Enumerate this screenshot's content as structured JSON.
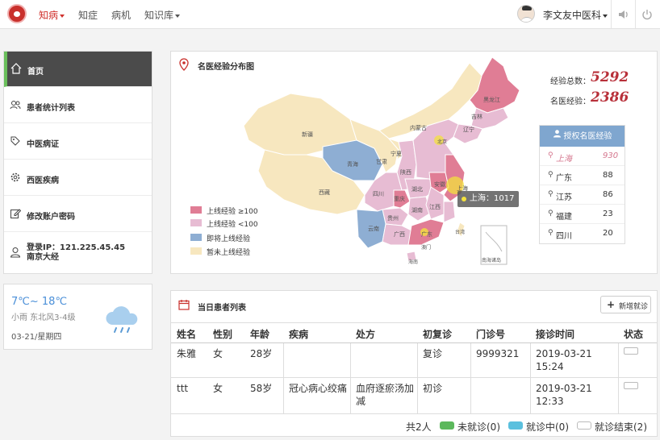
{
  "nav": {
    "items": [
      {
        "label": "知病",
        "has_caret": true,
        "active": true
      },
      {
        "label": "知症",
        "has_caret": false
      },
      {
        "label": "病机",
        "has_caret": false
      },
      {
        "label": "知识库",
        "has_caret": true
      }
    ],
    "user_name": "李文友",
    "department": "中医科",
    "volume_icon": "volume-icon",
    "power_icon": "power-icon"
  },
  "sidebar": {
    "items": [
      {
        "label": "首页",
        "icon": "home-icon",
        "active": true
      },
      {
        "label": "患者统计列表",
        "icon": "users-icon"
      },
      {
        "label": "中医病证",
        "icon": "tag-icon"
      },
      {
        "label": "西医疾病",
        "icon": "gear-icon"
      },
      {
        "label": "修改账户密码",
        "icon": "edit-icon"
      }
    ],
    "login_ip_label": "登录IP：121.225.45.45",
    "login_location": "南京大经"
  },
  "weather": {
    "temp": "7℃~ 18℃",
    "desc": "小雨   东北风3-4级",
    "date": "03-21/星期四"
  },
  "map_panel": {
    "title": "名医经验分布图",
    "total_label": "经验总数：",
    "total_value": "5292",
    "doctor_label": "名医经验：",
    "doctor_value": "2386",
    "ranking_header": "授权名医经验",
    "ranking": [
      {
        "prov": "上海",
        "count": "930",
        "highlight": true
      },
      {
        "prov": "广东",
        "count": "88"
      },
      {
        "prov": "江苏",
        "count": "86"
      },
      {
        "prov": "福建",
        "count": "23"
      },
      {
        "prov": "四川",
        "count": "20"
      }
    ],
    "legend": [
      {
        "label": "上线经验 ≥100",
        "color": "#e07d95"
      },
      {
        "label": "上线经验 <100",
        "color": "#e7bcd3"
      },
      {
        "label": "即将上线经验",
        "color": "#8eaed3"
      },
      {
        "label": "暂未上线经验",
        "color": "#f7e7bf"
      }
    ],
    "tooltip": "上海：1017",
    "map_labels": {
      "heilongjiang": "黑龙江",
      "neimenggu": "内蒙古",
      "jilin": "吉林",
      "xinjiang": "新疆",
      "liaoning": "辽宁",
      "beijing": "北京",
      "ningxia": "宁夏",
      "qinghai": "青海",
      "gansu": "甘肃",
      "shaanxi": "陕西",
      "xizang": "西藏",
      "sichuan": "四川",
      "chongqing": "重庆",
      "anhui": "安徽",
      "shanghai": "上海",
      "hubei": "湖北",
      "jiangxi": "江西",
      "guizhou": "贵州",
      "hunan": "湖南",
      "yunnan": "云南",
      "guangxi": "广西",
      "guangdong": "广东",
      "taiwan": "台湾",
      "aomen": "澳门",
      "hainan": "海南",
      "nanhai": "南海诸岛"
    },
    "colors": {
      "high": "#e07d95",
      "low": "#e7bcd3",
      "soon": "#8eaed3",
      "none": "#f7e7bf"
    }
  },
  "patients": {
    "title": "当日患者列表",
    "new_button": "新增就诊",
    "columns": [
      "姓名",
      "性别",
      "年龄",
      "疾病",
      "处方",
      "初复诊",
      "门诊号",
      "接诊时间",
      "状态"
    ],
    "rows": [
      {
        "name": "朱雅",
        "sex": "女",
        "age": "28岁",
        "disease": "",
        "prescription": "",
        "visit": "复诊",
        "clinic_no": "9999321",
        "time": "2019-03-21 15:24"
      },
      {
        "name": "ttt",
        "sex": "女",
        "age": "58岁",
        "disease": "冠心病心绞痛",
        "prescription": "血府逐瘀汤加减",
        "visit": "初诊",
        "clinic_no": "",
        "time": "2019-03-21 12:33"
      }
    ],
    "total": "共2人",
    "status_legend": [
      {
        "label": "未就诊(0)",
        "color": "#5cb85c"
      },
      {
        "label": "就诊中(0)",
        "color": "#5bc0de"
      },
      {
        "label": "就诊结束(2)",
        "color": "#ffffff"
      }
    ]
  }
}
